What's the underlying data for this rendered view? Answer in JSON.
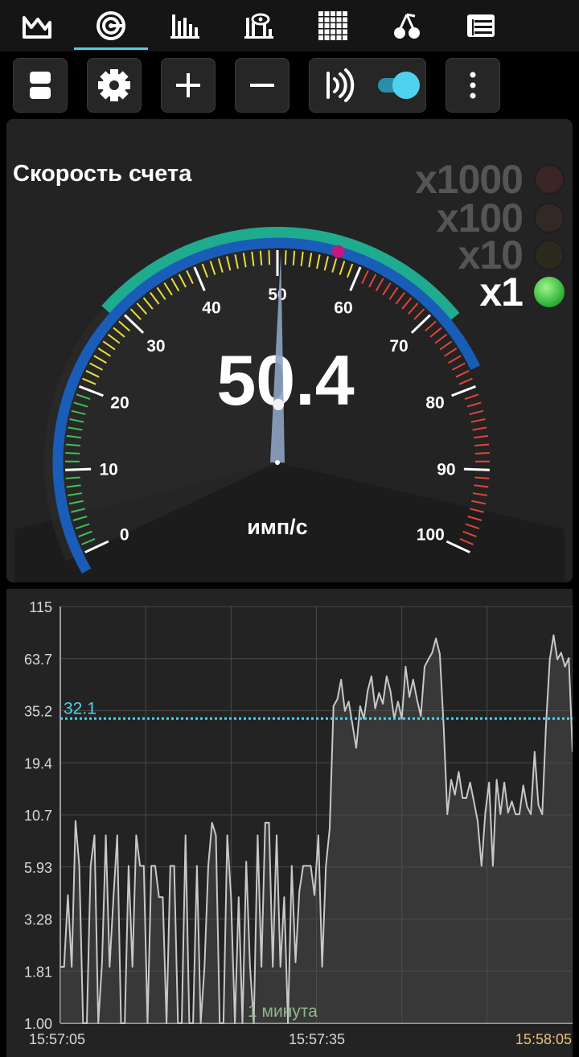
{
  "tabs": [
    {
      "name": "tab-graph",
      "icon": "area-graph-icon"
    },
    {
      "name": "tab-dosimeter",
      "icon": "dosimeter-gauge-icon",
      "active": true
    },
    {
      "name": "tab-spectrum",
      "icon": "bar-histogram-icon"
    },
    {
      "name": "tab-spectrum-analysis",
      "icon": "histogram-eye-icon"
    },
    {
      "name": "tab-grid",
      "icon": "grid-icon"
    },
    {
      "name": "tab-isotopes",
      "icon": "cherry-icon"
    },
    {
      "name": "tab-table",
      "icon": "table-icon"
    }
  ],
  "toolbar": {
    "buttons": [
      "layout-toggle-button",
      "settings-button",
      "zoom-in-button",
      "zoom-out-button",
      "connection-button",
      "menu-button"
    ],
    "connection_toggle_on": true
  },
  "gauge": {
    "title": "Скорость счета",
    "value": "50.4",
    "unit": "имп/с",
    "min": 0,
    "max": 100,
    "reading": 50.4,
    "scale_labels": [
      "0",
      "10",
      "20",
      "30",
      "40",
      "50",
      "60",
      "70",
      "80",
      "90",
      "100"
    ],
    "multipliers": [
      {
        "label": "x1000",
        "active": false
      },
      {
        "label": "x100",
        "active": false
      },
      {
        "label": "x10",
        "active": false
      },
      {
        "label": "x1",
        "active": true
      }
    ],
    "colors": {
      "green": "#3fbf55",
      "yellow": "#e8e03a",
      "red": "#e0443a",
      "blue_arc": "#1a5db8",
      "teal_arc": "#1fab8e",
      "marker": "#c2187f"
    }
  },
  "chart": {
    "y_ticks": [
      "115",
      "63.7",
      "35.2",
      "19.4",
      "10.7",
      "5.93",
      "3.28",
      "1.81",
      "1.00"
    ],
    "threshold_label": "32.1",
    "threshold_value": 32.1,
    "window_label": "1 минута",
    "x_ticks": [
      "15:57:05",
      "15:57:35",
      "15:58:05"
    ],
    "colors": {
      "line": "#c8c8c8",
      "threshold": "#4fd2ea",
      "window": "#8fb58f",
      "last_time": "#e8c27a"
    }
  },
  "chart_data": {
    "type": "area",
    "title": "",
    "xlabel": "",
    "ylabel": "",
    "y_scale": "log",
    "ylim": [
      1.0,
      115
    ],
    "x": [
      "15:57:05",
      "15:57:35",
      "15:58:05"
    ],
    "series": [
      {
        "values": [
          1.9,
          1.9,
          4.3,
          1.9,
          10,
          6,
          1.0,
          1.0,
          6,
          8.5,
          1.0,
          2.0,
          8.5,
          1.9,
          4.2,
          8.5,
          1.0,
          1.0,
          6,
          1.9,
          8.5,
          6,
          6,
          1.0,
          6,
          6,
          4.2,
          4.2,
          1.0,
          6,
          6,
          1.0,
          1.0,
          8.5,
          1.0,
          1.0,
          6,
          1.0,
          1.9,
          6,
          9.8,
          8.5,
          1.0,
          1.0,
          8.5,
          4.2,
          1.0,
          4.2,
          1.0,
          6.3,
          1.9,
          1.0,
          8.5,
          1.9,
          9.8,
          9.8,
          1.9,
          8.5,
          1.9,
          4.2,
          1.0,
          6,
          2.0,
          4.5,
          6,
          6,
          6,
          4.3,
          8.5,
          1.9,
          6,
          9.2,
          37,
          40,
          50,
          35,
          39,
          30,
          23,
          37,
          32,
          44,
          52,
          36,
          43,
          38,
          52,
          44,
          32,
          39,
          32,
          58,
          41,
          50,
          40,
          33,
          58,
          63,
          68,
          80,
          67,
          30,
          10.8,
          16,
          13.5,
          17.5,
          13,
          13,
          15.5,
          12.5,
          10,
          6,
          11,
          15.5,
          6,
          16,
          10.8,
          15.5,
          11,
          12.5,
          10.8,
          10.8,
          15,
          11.8,
          10.8,
          22,
          12,
          10.8,
          30,
          63,
          83,
          63,
          68,
          58,
          64,
          22
        ]
      }
    ]
  }
}
